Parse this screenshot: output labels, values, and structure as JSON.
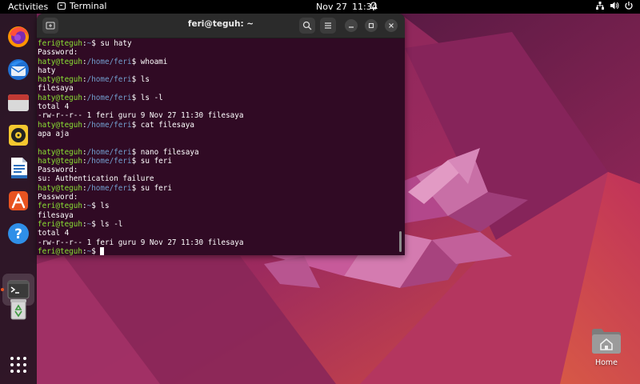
{
  "topbar": {
    "activities": "Activities",
    "app_name": "Terminal",
    "date": "Nov 27",
    "time": "11:34"
  },
  "dock": {
    "items": [
      {
        "name": "firefox"
      },
      {
        "name": "thunderbird"
      },
      {
        "name": "files"
      },
      {
        "name": "rhythmbox"
      },
      {
        "name": "libreoffice-writer"
      },
      {
        "name": "app-center"
      },
      {
        "name": "help"
      },
      {
        "name": "terminal",
        "active": true
      },
      {
        "name": "trash"
      },
      {
        "name": "show-apps"
      }
    ]
  },
  "window": {
    "title": "feri@teguh: ~"
  },
  "terminal": {
    "lines": [
      {
        "user": "feri@teguh",
        "path": "~",
        "cmd": "su haty"
      },
      {
        "text": "Password:"
      },
      {
        "user": "haty@teguh",
        "path": "/home/feri",
        "cmd": "whoami"
      },
      {
        "text": "haty"
      },
      {
        "user": "haty@teguh",
        "path": "/home/feri",
        "cmd": "ls"
      },
      {
        "text": "filesaya"
      },
      {
        "user": "haty@teguh",
        "path": "/home/feri",
        "cmd": "ls -l"
      },
      {
        "text": "total 4"
      },
      {
        "text": "-rw-r--r-- 1 feri guru 9 Nov 27 11:30 filesaya"
      },
      {
        "user": "haty@teguh",
        "path": "/home/feri",
        "cmd": "cat filesaya"
      },
      {
        "text": "apa aja"
      },
      {
        "text": ""
      },
      {
        "user": "haty@teguh",
        "path": "/home/feri",
        "cmd": "nano filesaya"
      },
      {
        "user": "haty@teguh",
        "path": "/home/feri",
        "cmd": "su feri"
      },
      {
        "text": "Password:"
      },
      {
        "text": "su: Authentication failure"
      },
      {
        "user": "haty@teguh",
        "path": "/home/feri",
        "cmd": "su feri"
      },
      {
        "text": "Password:"
      },
      {
        "user": "feri@teguh",
        "path": "~",
        "cmd": "ls"
      },
      {
        "text": "filesaya"
      },
      {
        "user": "feri@teguh",
        "path": "~",
        "cmd": "ls -l"
      },
      {
        "text": "total 4"
      },
      {
        "text": "-rw-r--r-- 1 feri guru 9 Nov 27 11:30 filesaya"
      },
      {
        "user": "feri@teguh",
        "path": "~",
        "cmd": "",
        "cursor": true
      }
    ]
  },
  "desktop": {
    "home_label": "Home"
  },
  "colors": {
    "terminal_bg": "#300a24",
    "prompt_user": "#8ae234",
    "prompt_path": "#729fcf",
    "ubuntu_orange": "#e95420"
  }
}
